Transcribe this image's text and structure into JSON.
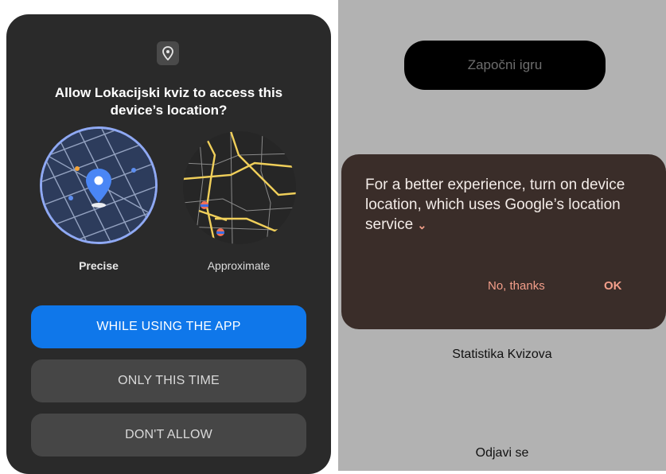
{
  "permission_dialog": {
    "icon": "location-pin-icon",
    "title": "Allow Lokacijski kviz to access this device’s location?",
    "options": {
      "precise_label": "Precise",
      "approximate_label": "Approximate",
      "selected": "Precise"
    },
    "buttons": {
      "while_using": "WHILE USING THE APP",
      "only_this_time": "ONLY THIS TIME",
      "dont_allow": "DON'T ALLOW"
    }
  },
  "app_screen": {
    "start_button": "Započni igru",
    "stats_link": "Statistika Kvizova",
    "logout_link": "Odjavi se"
  },
  "location_prompt": {
    "message": "For a better experience, turn on device location, which uses Google’s location service",
    "expand_icon": "chevron-down-icon",
    "no_label": "No, thanks",
    "ok_label": "OK"
  },
  "colors": {
    "primary_button": "#0f77ea",
    "dialog_bg": "#2a2a2a",
    "snackbar_bg": "#3a2d29",
    "snackbar_action": "#f39e8a",
    "app_bg": "#b2b2b2"
  }
}
